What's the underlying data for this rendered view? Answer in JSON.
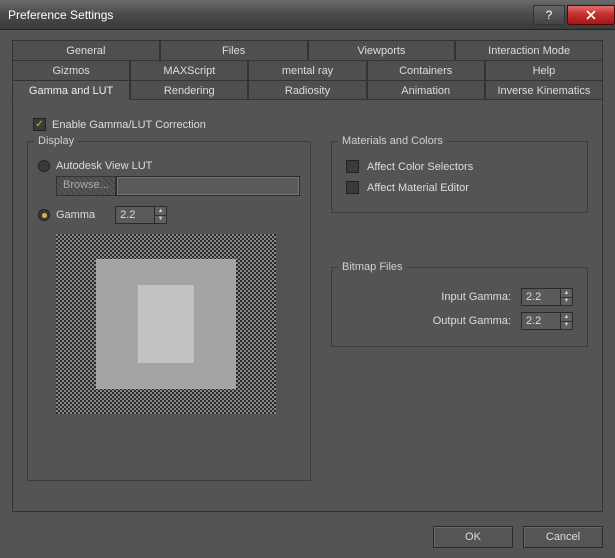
{
  "window": {
    "title": "Preference Settings"
  },
  "tabs": {
    "row1": [
      "General",
      "Files",
      "Viewports",
      "Interaction Mode"
    ],
    "row2": [
      "Gizmos",
      "MAXScript",
      "mental ray",
      "Containers",
      "Help"
    ],
    "row3": [
      "Gamma and LUT",
      "Rendering",
      "Radiosity",
      "Animation",
      "Inverse Kinematics"
    ],
    "active": "Gamma and LUT"
  },
  "enable_gamma": {
    "label": "Enable Gamma/LUT Correction",
    "checked": true
  },
  "display": {
    "legend": "Display",
    "autodesk_lut": {
      "label": "Autodesk View LUT",
      "selected": false
    },
    "browse_label": "Browse...",
    "gamma_radio": {
      "label": "Gamma",
      "selected": true
    },
    "gamma_value": "2.2"
  },
  "materials": {
    "legend": "Materials and Colors",
    "affect_color": {
      "label": "Affect Color Selectors",
      "checked": false
    },
    "affect_mat": {
      "label": "Affect Material Editor",
      "checked": false
    }
  },
  "bitmap": {
    "legend": "Bitmap Files",
    "input_label": "Input Gamma:",
    "input_value": "2.2",
    "output_label": "Output Gamma:",
    "output_value": "2.2"
  },
  "footer": {
    "ok": "OK",
    "cancel": "Cancel"
  }
}
